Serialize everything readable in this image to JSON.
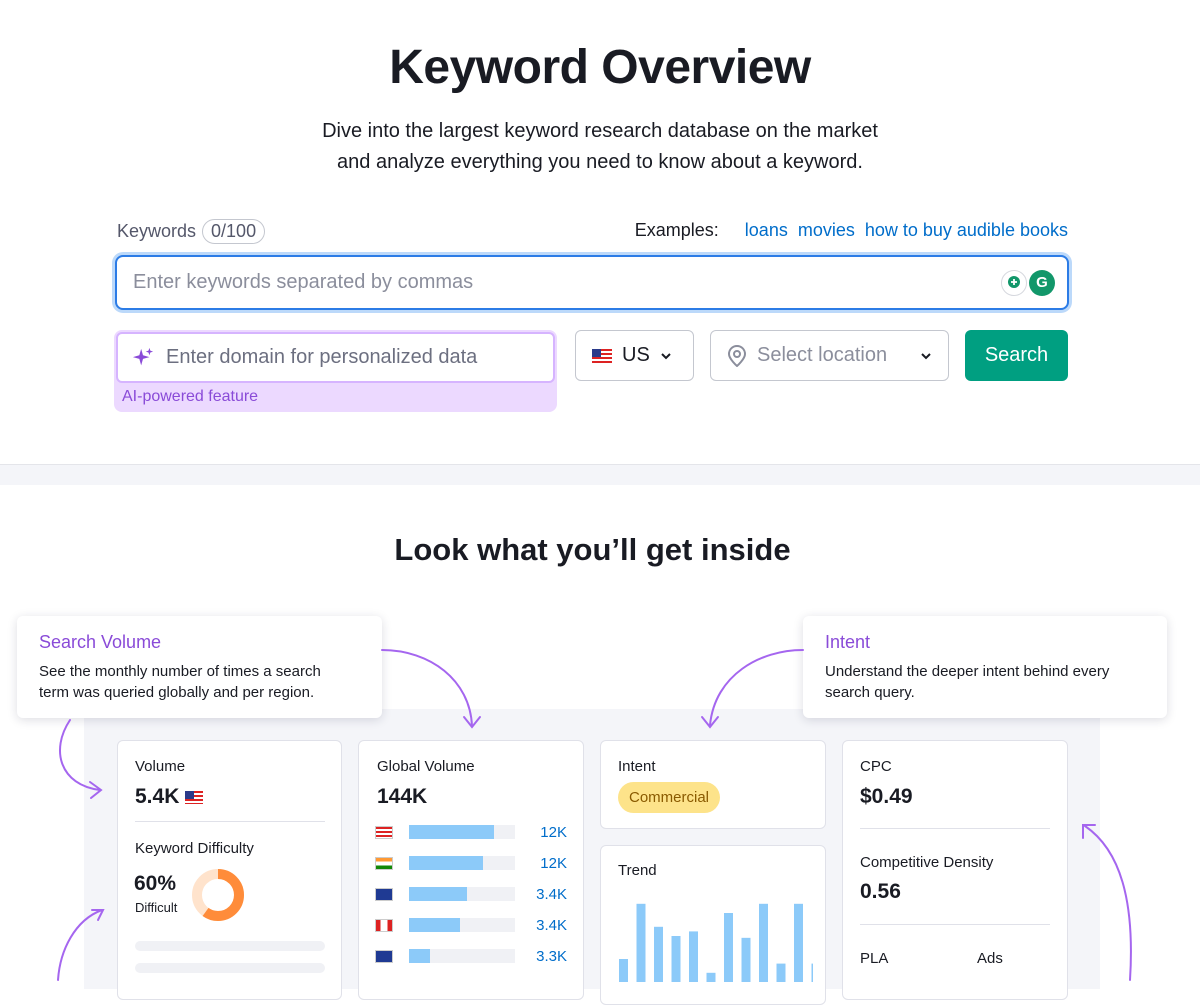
{
  "header": {
    "title": "Keyword Overview",
    "subtitle_line1": "Dive into the largest keyword research database on the market",
    "subtitle_line2": "and analyze everything you need to know about a keyword."
  },
  "form": {
    "keywords_label": "Keywords",
    "keywords_count": "0/100",
    "examples_label": "Examples:",
    "examples": [
      "loans",
      "movies",
      "how to buy audible books"
    ],
    "keywords_placeholder": "Enter keywords separated by commas",
    "domain_placeholder": "Enter domain for personalized data",
    "ai_label": "AI-powered feature",
    "country": "US",
    "location_placeholder": "Select location",
    "search_label": "Search"
  },
  "section2": {
    "title": "Look what you’ll get inside"
  },
  "callouts": {
    "volume": {
      "title": "Search Volume",
      "desc_line1": "See the monthly number of times a search",
      "desc_line2": "term was queried globally and per region."
    },
    "intent": {
      "title": "Intent",
      "desc_line1": "Understand the deeper intent behind every",
      "desc_line2": "search query."
    }
  },
  "cards": {
    "volume": {
      "label": "Volume",
      "value": "5.4K"
    },
    "kd": {
      "label": "Keyword Difficulty",
      "value": "60%",
      "level": "Difficult",
      "percent": 60
    },
    "global": {
      "label": "Global Volume",
      "value": "144K",
      "rows": [
        {
          "flag": "us",
          "fill": 0.8,
          "value": "12K"
        },
        {
          "flag": "in",
          "fill": 0.7,
          "value": "12K"
        },
        {
          "flag": "gb",
          "fill": 0.55,
          "value": "3.4K"
        },
        {
          "flag": "ca",
          "fill": 0.48,
          "value": "3.4K"
        },
        {
          "flag": "au",
          "fill": 0.2,
          "value": "3.3K"
        }
      ]
    },
    "intent": {
      "label": "Intent",
      "value": "Commercial"
    },
    "trend": {
      "label": "Trend",
      "values": [
        0.25,
        0.85,
        0.6,
        0.5,
        0.55,
        0.1,
        0.75,
        0.48,
        0.85,
        0.2,
        0.85,
        0.2
      ]
    },
    "cpc": {
      "label": "CPC",
      "value": "$0.49"
    },
    "density": {
      "label": "Competitive Density",
      "value": "0.56"
    },
    "pla": {
      "label": "PLA"
    },
    "ads": {
      "label": "Ads"
    }
  },
  "colors": {
    "accent": "#2c7ce6",
    "search_button": "#009f81",
    "ai_purple": "#8a4bd8",
    "bar": "#8ccaf9",
    "kd_orange": "#ff8c3a",
    "intent_pill": "#fde38a"
  }
}
